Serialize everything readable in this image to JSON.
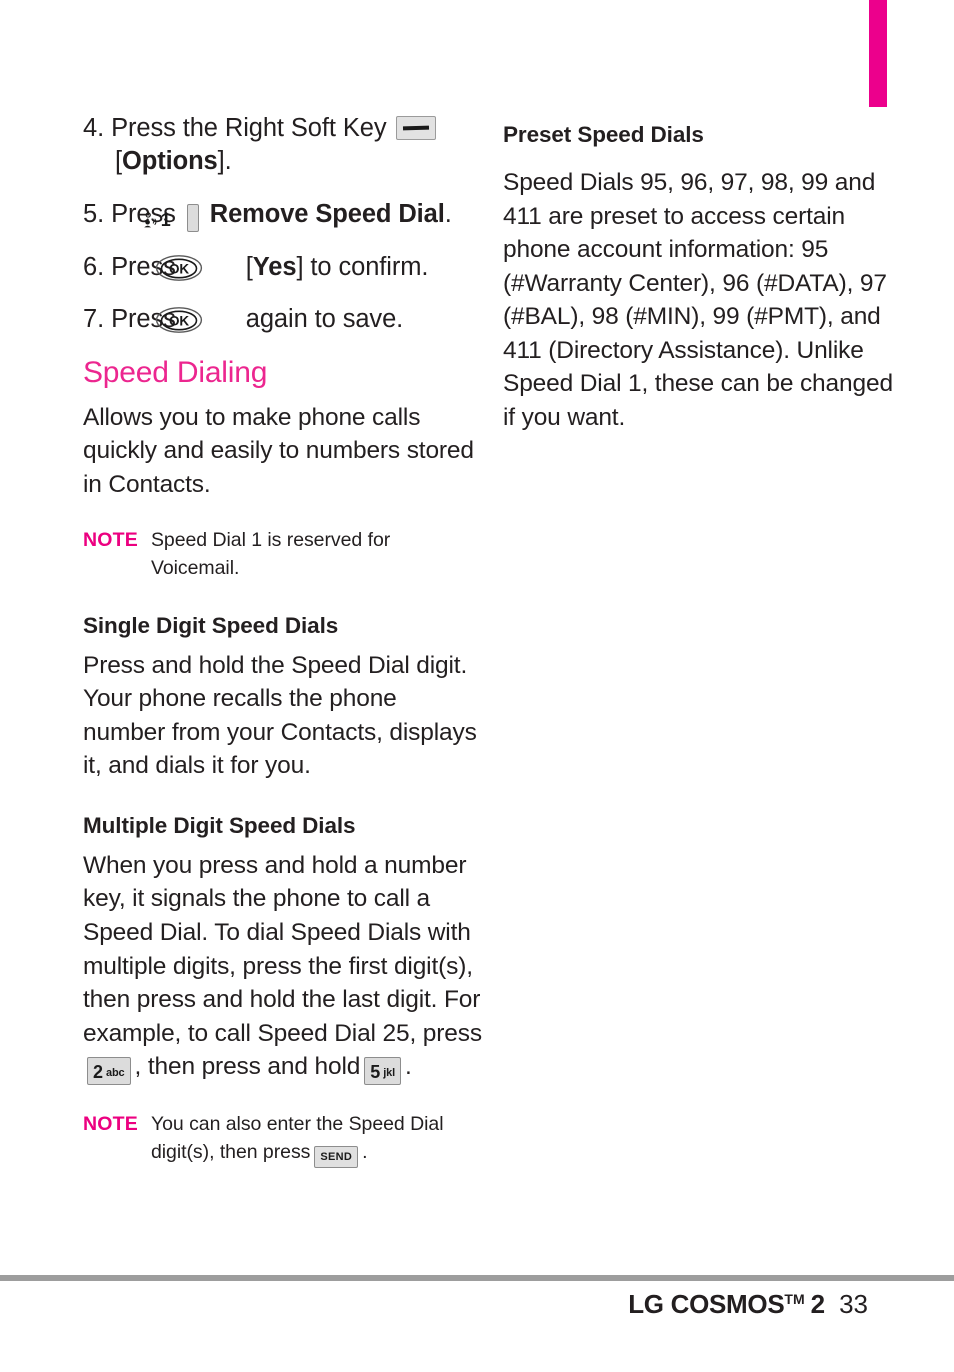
{
  "page": {
    "number": "33",
    "accent_magenta": "#ec008c",
    "heading_magenta": "#ec268f",
    "note_magenta": "#ec0080"
  },
  "left_column": {
    "steps": [
      {
        "number": "4.",
        "text_before": "Press the Right Soft Key",
        "icon": "right-soft-key-icon",
        "text_after": "[",
        "bold_after": "Options",
        "text_end": "]."
      },
      {
        "number": "5.",
        "text_before": "Press",
        "icon": "keypad-key-1-voicemail-icon",
        "bold_after": "Remove Speed Dial",
        "text_end": "."
      },
      {
        "number": "6.",
        "text_before": "Press",
        "icon": "ok-key-icon",
        "text_after": "[",
        "bold_after": "Yes",
        "text_end": "] to confirm."
      },
      {
        "number": "7.",
        "text_before": "Press",
        "icon": "ok-key-icon",
        "text_end": "again to save."
      }
    ],
    "section_heading": "Speed Dialing",
    "intro_paragraph": "Allows you to make phone calls quickly and easily to numbers stored in Contacts.",
    "note_1": {
      "label": "NOTE",
      "text": "Speed Dial 1 is reserved for Voicemail."
    },
    "subheading_single": "Single Digit Speed Dials",
    "paragraph_single": "Press and hold the Speed Dial digit. Your phone recalls the phone number from your Contacts, displays it, and dials it for you.",
    "subheading_multiple": "Multiple Digit Speed Dials",
    "paragraph_multiple_part1": "When you press and hold a number key, it signals the phone to call a Speed Dial. To dial Speed Dials with multiple digits, press the first digit(s), then press and hold the last digit. For example, to call Speed Dial 25, press",
    "paragraph_multiple_part2": ", then press and hold",
    "paragraph_multiple_part3": ".",
    "key_2": {
      "digit": "2",
      "letters": "abc"
    },
    "key_5": {
      "digit": "5",
      "letters": "jkl"
    },
    "note_2": {
      "label": "NOTE",
      "text_before": "You can also enter the Speed Dial digit(s), then press",
      "icon_label": "SEND",
      "text_after": "."
    },
    "key_1": {
      "digit": "1"
    }
  },
  "right_column": {
    "subheading": "Preset Speed Dials",
    "paragraph": "Speed Dials 95, 96, 97, 98, 99 and 411 are preset to access certain phone account information: 95 (#Warranty Center), 96 (#DATA), 97 (#BAL), 98 (#MIN), 99 (#PMT), and 411 (Directory Assistance). Unlike Speed Dial 1, these can be changed if you want."
  },
  "footer": {
    "brand": "LG COSMOS",
    "trademark": "TM",
    "model": "2",
    "page_number": "33"
  }
}
